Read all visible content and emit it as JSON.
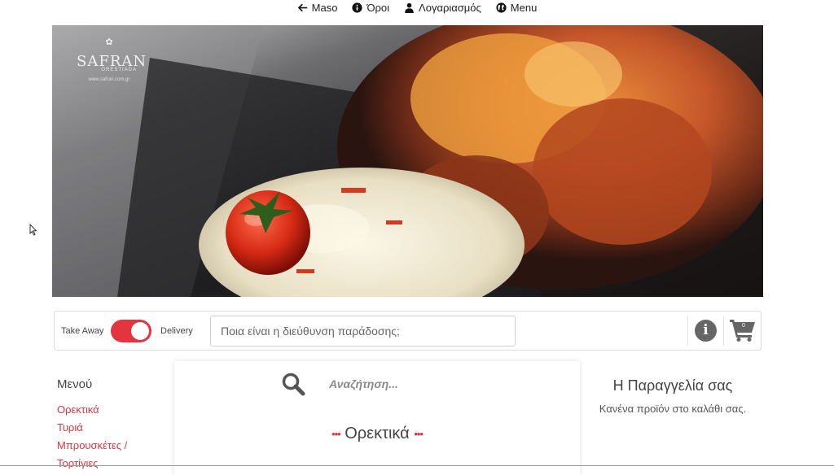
{
  "topnav": {
    "items": [
      {
        "label": "Maso",
        "icon": "arrow-left-icon"
      },
      {
        "label": "Όροι",
        "icon": "info-circle-icon"
      },
      {
        "label": "Λογαριασμός",
        "icon": "user-icon"
      },
      {
        "label": "Menu",
        "icon": "globe-icon"
      }
    ]
  },
  "hero": {
    "logo_brand": "SAFRAN",
    "logo_sub": "ORESTIADA",
    "logo_url": "www.safran.com.gr"
  },
  "orderbar": {
    "takeaway_label": "Take Away",
    "delivery_label": "Delivery",
    "delivery_selected": true,
    "address_placeholder": "Ποια είναι η διεύθυνση παράδοσης;",
    "cart_count": "0",
    "accent_color": "#e3343f"
  },
  "sidebar": {
    "title": "Μενού",
    "items": [
      {
        "label": "Ορεκτικά"
      },
      {
        "label": "Τυριά"
      },
      {
        "label": "Μπρουσκέτες /"
      },
      {
        "label": "Τορτίγιες"
      }
    ]
  },
  "main": {
    "search_placeholder": "Αναζήτηση...",
    "section_title": "Ορεκτικά",
    "section_dots": "•••"
  },
  "order": {
    "title": "Η Παραγγελία σας",
    "empty_text": "Κανένα προϊόν στο καλάθι σας."
  }
}
